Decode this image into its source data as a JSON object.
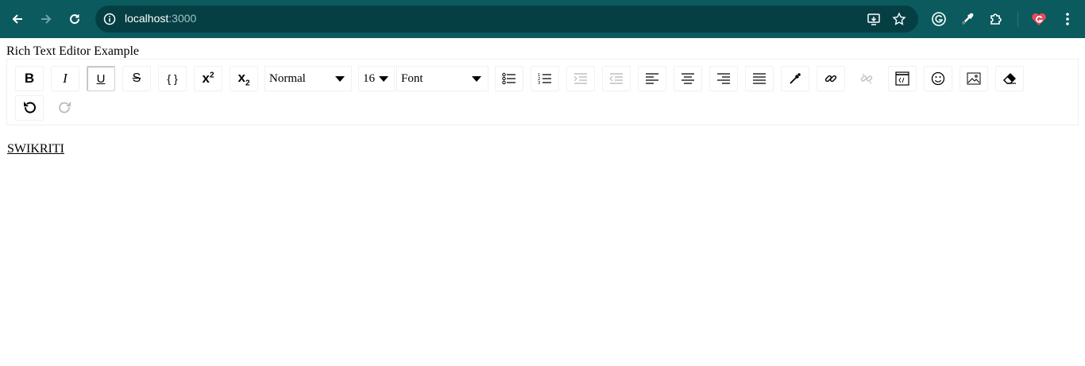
{
  "browser": {
    "url_host": "localhost",
    "url_port": ":3000",
    "icons": {
      "back": "back-arrow-icon",
      "forward": "forward-arrow-icon",
      "reload": "reload-icon",
      "site_info": "site-info-icon",
      "install": "install-app-icon",
      "bookmark": "star-icon",
      "grammarly": "grammarly-icon",
      "dropper": "color-dropper-icon",
      "extensions": "puzzle-icon",
      "profile": "heart-g-extension-icon",
      "menu": "kebab-menu-icon"
    },
    "colors": {
      "frame": "#0b5a5e",
      "omnibox": "#053f44"
    }
  },
  "page": {
    "title": "Rich Text Editor Example"
  },
  "toolbar": {
    "bold_label": "B",
    "italic_label": "I",
    "underline_label": "U",
    "strike_label": "S",
    "code_label": "{ }",
    "superscript_label": "x",
    "superscript_mark": "2",
    "subscript_label": "x",
    "subscript_mark": "2",
    "block_type": "Normal",
    "font_size": "16",
    "font_family": "Font"
  },
  "editor": {
    "content": "SWIKRITI"
  }
}
